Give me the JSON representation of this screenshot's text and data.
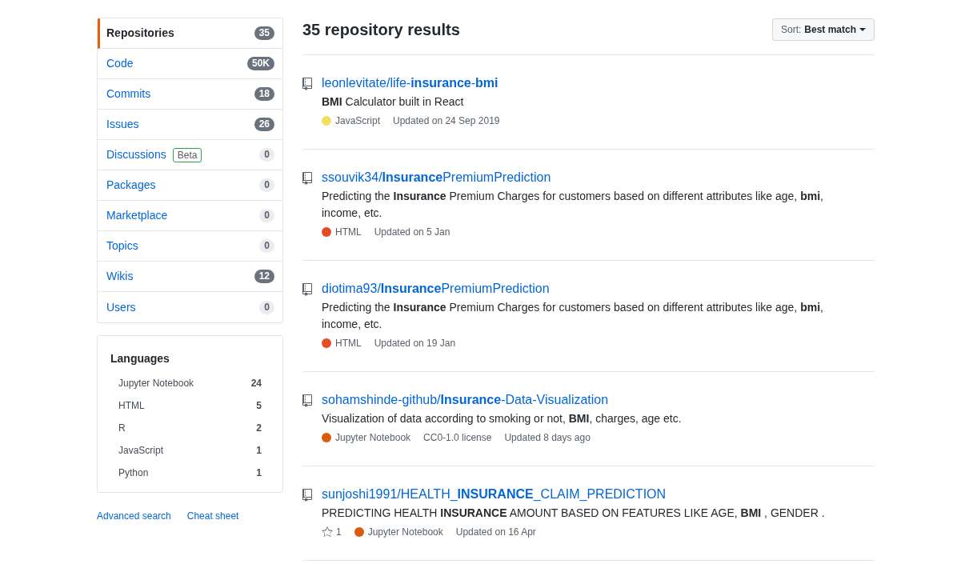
{
  "sidebar": {
    "nav": [
      {
        "label": "Repositories",
        "count": "35",
        "selected": true,
        "muted": false
      },
      {
        "label": "Code",
        "count": "50K",
        "selected": false,
        "muted": false
      },
      {
        "label": "Commits",
        "count": "18",
        "selected": false,
        "muted": false
      },
      {
        "label": "Issues",
        "count": "26",
        "selected": false,
        "muted": false
      },
      {
        "label": "Discussions",
        "badge": "Beta",
        "count": "0",
        "selected": false,
        "muted": true
      },
      {
        "label": "Packages",
        "count": "0",
        "selected": false,
        "muted": true
      },
      {
        "label": "Marketplace",
        "count": "0",
        "selected": false,
        "muted": true
      },
      {
        "label": "Topics",
        "count": "0",
        "selected": false,
        "muted": true
      },
      {
        "label": "Wikis",
        "count": "12",
        "selected": false,
        "muted": false
      },
      {
        "label": "Users",
        "count": "0",
        "selected": false,
        "muted": true
      }
    ],
    "languages": {
      "title": "Languages",
      "items": [
        {
          "name": "Jupyter Notebook",
          "count": "24"
        },
        {
          "name": "HTML",
          "count": "5"
        },
        {
          "name": "R",
          "count": "2"
        },
        {
          "name": "JavaScript",
          "count": "1"
        },
        {
          "name": "Python",
          "count": "1"
        }
      ]
    },
    "links": [
      "Advanced search",
      "Cheat sheet"
    ]
  },
  "results": {
    "heading": "35 repository results",
    "sort": {
      "label": "Sort:",
      "value": "Best match"
    },
    "items": [
      {
        "name": "leonlevitate/life-**insurance**-**bmi**",
        "description": "**BMI** Calculator built in React",
        "language": "JavaScript",
        "color": "#f1e05a",
        "updated": "Updated on 24 Sep 2019"
      },
      {
        "name": "ssouvik34/**Insurance**PremiumPrediction",
        "description": "Predicting the **Insurance** Premium Charges for customers based on different attributes like age, **bmi**, income, etc.",
        "language": "HTML",
        "color": "#e34c26",
        "updated": "Updated on 5 Jan"
      },
      {
        "name": "diotima93/**Insurance**PremiumPrediction",
        "description": "Predicting the **Insurance** Premium Charges for customers based on different attributes like age, **bmi**, income, etc.",
        "language": "HTML",
        "color": "#e34c26",
        "updated": "Updated on 19 Jan"
      },
      {
        "name": "sohamshinde-github/**Insurance**-Data-Visualization",
        "description": "Visualization of data according to smoking or not, **BMI**, charges, age etc.",
        "language": "Jupyter Notebook",
        "color": "#da5b0b",
        "license": "CC0-1.0 license",
        "updated": "Updated 8 days ago"
      },
      {
        "name": "sunjoshi1991/HEALTH_**INSURANCE**_CLAIM_PREDICTION",
        "description": "PREDICTING HEALTH **INSURANCE** AMOUNT BASED ON FEATURES LIKE AGE, **BMI** , GENDER .",
        "stars": "1",
        "language": "Jupyter Notebook",
        "color": "#da5b0b",
        "updated": "Updated on 16 Apr"
      }
    ]
  }
}
